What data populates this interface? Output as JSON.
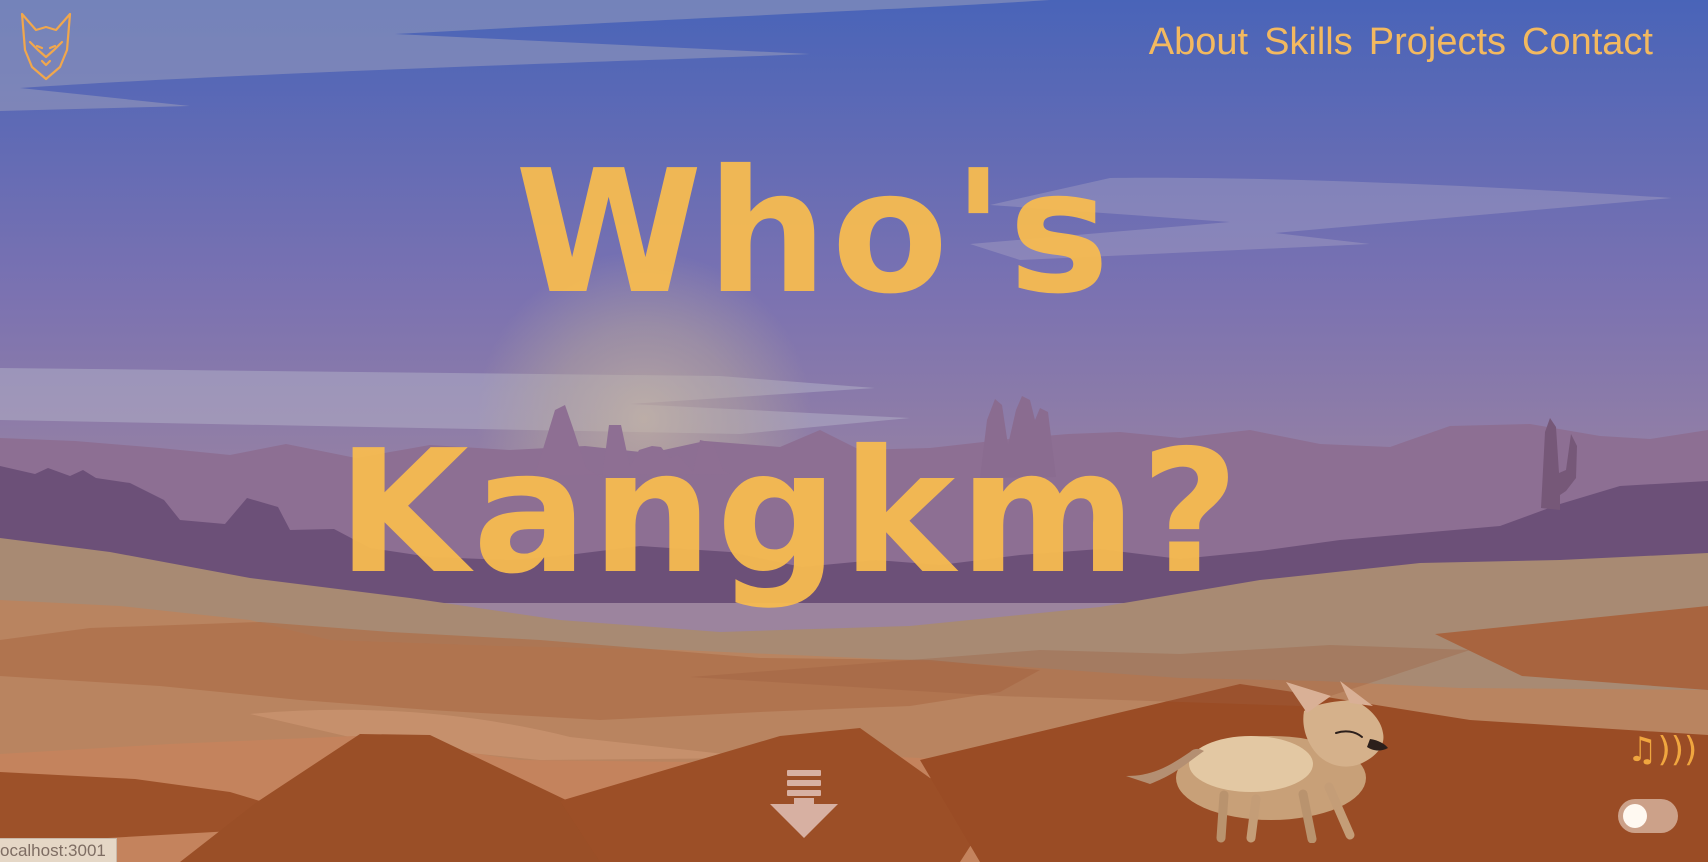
{
  "header": {
    "logo_icon": "fox-head-icon",
    "nav": [
      {
        "label": "About"
      },
      {
        "label": "Skills"
      },
      {
        "label": "Projects"
      },
      {
        "label": "Contact"
      }
    ]
  },
  "hero": {
    "title_line_1": "Who's",
    "title_line_2": "Kangkm?"
  },
  "controls": {
    "scroll_icon": "download-arrow-icon",
    "music_glyph": "♫)))",
    "music_icon": "music-note-icon",
    "toggle_icon": "toggle-switch-icon"
  },
  "status": {
    "url": "ocalhost:3001"
  },
  "colors": {
    "accent": "#f3b95f",
    "title": "#f8bc50",
    "sky_top": "#4663b8",
    "sky_mid": "#7c71b0",
    "dune": "#b47a57"
  }
}
